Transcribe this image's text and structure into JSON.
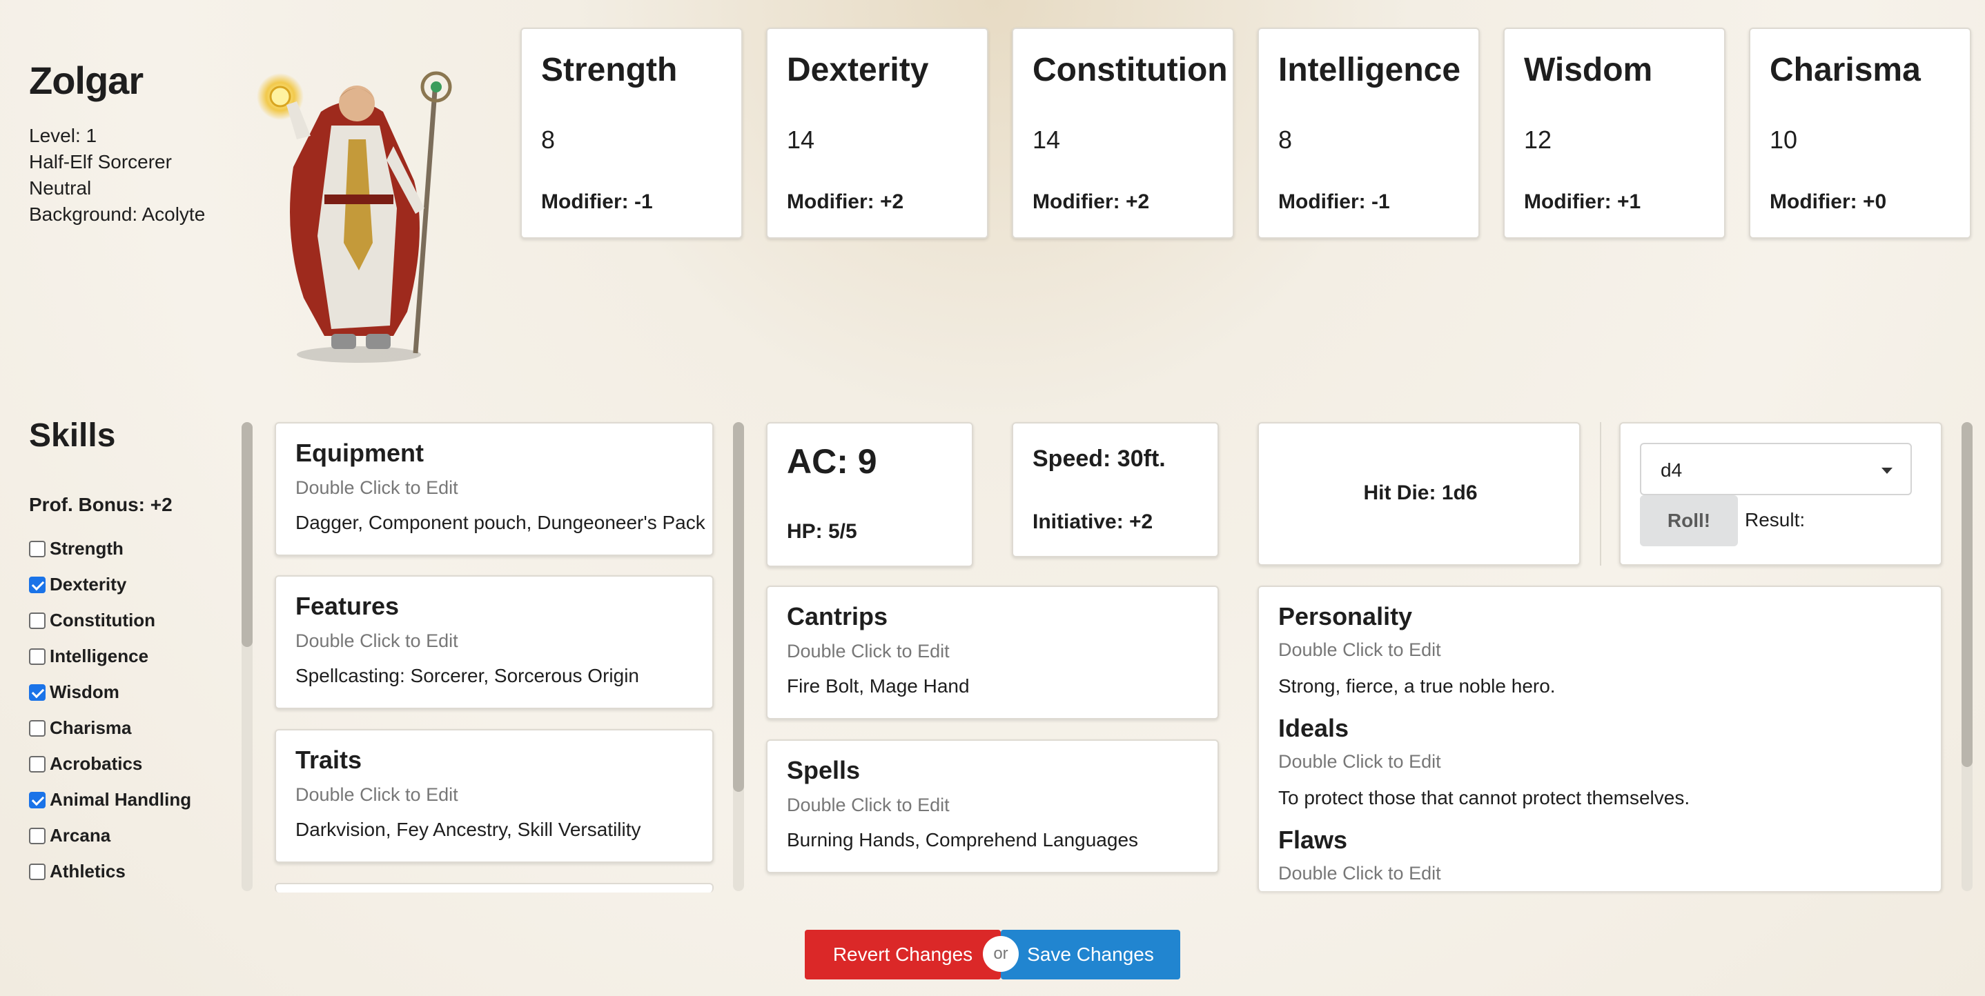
{
  "character": {
    "name": "Zolgar",
    "level": "Level: 1",
    "race_class": "Half-Elf Sorcerer",
    "alignment": "Neutral",
    "background": "Background: Acolyte"
  },
  "abilities": [
    {
      "name": "Strength",
      "score": "8",
      "modifier": "Modifier: -1"
    },
    {
      "name": "Dexterity",
      "score": "14",
      "modifier": "Modifier: +2"
    },
    {
      "name": "Constitution",
      "score": "14",
      "modifier": "Modifier: +2"
    },
    {
      "name": "Intelligence",
      "score": "8",
      "modifier": "Modifier: -1"
    },
    {
      "name": "Wisdom",
      "score": "12",
      "modifier": "Modifier: +1"
    },
    {
      "name": "Charisma",
      "score": "10",
      "modifier": "Modifier: +0"
    }
  ],
  "skills": {
    "title": "Skills",
    "prof_bonus": "Prof. Bonus: +2",
    "items": [
      {
        "label": "Strength",
        "checked": false
      },
      {
        "label": "Dexterity",
        "checked": true
      },
      {
        "label": "Constitution",
        "checked": false
      },
      {
        "label": "Intelligence",
        "checked": false
      },
      {
        "label": "Wisdom",
        "checked": true
      },
      {
        "label": "Charisma",
        "checked": false
      },
      {
        "label": "Acrobatics",
        "checked": false
      },
      {
        "label": "Animal Handling",
        "checked": true
      },
      {
        "label": "Arcana",
        "checked": false
      },
      {
        "label": "Athletics",
        "checked": false
      }
    ]
  },
  "equipment": {
    "title": "Equipment",
    "hint": "Double Click to Edit",
    "body": "Dagger, Component pouch, Dungeoneer's Pack"
  },
  "features": {
    "title": "Features",
    "hint": "Double Click to Edit",
    "body": "Spellcasting: Sorcerer, Sorcerous Origin"
  },
  "traits": {
    "title": "Traits",
    "hint": "Double Click to Edit",
    "body": "Darkvision, Fey Ancestry, Skill Versatility"
  },
  "combat": {
    "ac": "AC: 9",
    "hp": "HP: 5/5",
    "speed": "Speed: 30ft.",
    "initiative": "Initiative: +2",
    "hit_die": "Hit Die: 1d6"
  },
  "dice": {
    "selected": "d4",
    "roll_label": "Roll!",
    "result_label": "Result:"
  },
  "cantrips": {
    "title": "Cantrips",
    "hint": "Double Click to Edit",
    "body": "Fire Bolt, Mage Hand"
  },
  "spells": {
    "title": "Spells",
    "hint": "Double Click to Edit",
    "body": "Burning Hands, Comprehend Languages"
  },
  "personality": {
    "title": "Personality",
    "hint": "Double Click to Edit",
    "body": "Strong, fierce, a true noble hero.",
    "ideals_title": "Ideals",
    "ideals_hint": "Double Click to Edit",
    "ideals_body": "To protect those that cannot protect themselves.",
    "flaws_title": "Flaws",
    "flaws_hint": "Double Click to Edit"
  },
  "actions": {
    "revert": "Revert Changes",
    "or": "or",
    "save": "Save Changes"
  },
  "colors": {
    "revert": "#db2828",
    "save": "#2185d0",
    "checkbox": "#1a73e8"
  }
}
